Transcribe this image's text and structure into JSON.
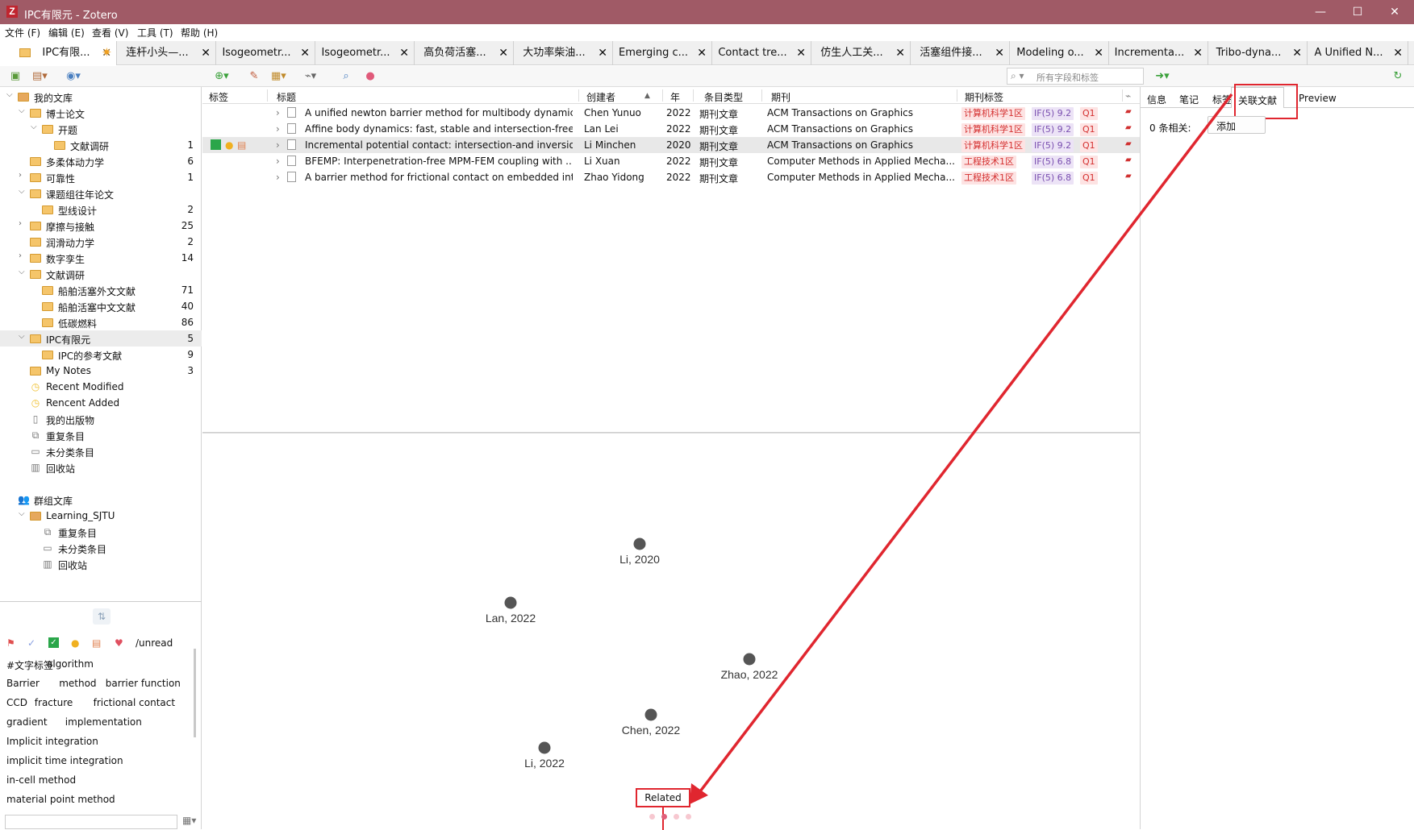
{
  "window": {
    "title": "IPC有限元 - Zotero",
    "logo": "Z",
    "minimize": "—",
    "maximize": "☐",
    "close": "✕"
  },
  "menu": [
    "文件 (F)",
    "编辑 (E)",
    "查看 (V)",
    "工具 (T)",
    "帮助 (H)"
  ],
  "tabs": [
    {
      "label": "IPC有限...",
      "active": true
    },
    {
      "label": "连杆小头—..."
    },
    {
      "label": "Isogeometr..."
    },
    {
      "label": "Isogeometr..."
    },
    {
      "label": "高负荷活塞..."
    },
    {
      "label": "大功率柴油..."
    },
    {
      "label": "Emerging c..."
    },
    {
      "label": "Contact tre..."
    },
    {
      "label": "仿生人工关..."
    },
    {
      "label": "活塞组件接..."
    },
    {
      "label": "Modeling o..."
    },
    {
      "label": "Incrementa..."
    },
    {
      "label": "Tribo-dyna..."
    },
    {
      "label": "A Unified N..."
    }
  ],
  "tab_close": "✕",
  "search": {
    "placeholder": "所有字段和标签"
  },
  "collections": [
    {
      "name": "我的文库",
      "level": 0,
      "chev": "v",
      "icon": "lib"
    },
    {
      "name": "博士论文",
      "level": 1,
      "chev": "v",
      "icon": "folder"
    },
    {
      "name": "开题",
      "level": 2,
      "chev": "v",
      "icon": "folder"
    },
    {
      "name": "文献调研",
      "level": 3,
      "icon": "folder",
      "count": "1"
    },
    {
      "name": "多柔体动力学",
      "level": 1,
      "icon": "folder",
      "count": "6"
    },
    {
      "name": "可靠性",
      "level": 1,
      "chev": ">",
      "icon": "folder",
      "count": "1"
    },
    {
      "name": "课题组往年论文",
      "level": 1,
      "chev": "v",
      "icon": "folder"
    },
    {
      "name": "型线设计",
      "level": 2,
      "icon": "folder",
      "count": "2"
    },
    {
      "name": "摩擦与接触",
      "level": 1,
      "chev": ">",
      "icon": "folder",
      "count": "25"
    },
    {
      "name": "润滑动力学",
      "level": 1,
      "icon": "folder",
      "count": "2"
    },
    {
      "name": "数字孪生",
      "level": 1,
      "chev": ">",
      "icon": "folder",
      "count": "14"
    },
    {
      "name": "文献调研",
      "level": 1,
      "chev": "v",
      "icon": "folder"
    },
    {
      "name": "船舶活塞外文文献",
      "level": 2,
      "icon": "folder",
      "count": "71"
    },
    {
      "name": "船舶活塞中文文献",
      "level": 2,
      "icon": "folder",
      "count": "40"
    },
    {
      "name": "低碳燃料",
      "level": 2,
      "icon": "folder",
      "count": "86"
    },
    {
      "name": "IPC有限元",
      "level": 1,
      "chev": "v",
      "icon": "folder",
      "count": "5",
      "selected": true
    },
    {
      "name": "IPC的参考文献",
      "level": 2,
      "icon": "folder",
      "count": "9"
    },
    {
      "name": "My Notes",
      "level": 1,
      "icon": "folder",
      "count": "3"
    },
    {
      "name": "Recent Modified",
      "level": 1,
      "icon": "clock"
    },
    {
      "name": "Rencent Added",
      "level": 1,
      "icon": "clock"
    },
    {
      "name": "我的出版物",
      "level": 1,
      "icon": "doc"
    },
    {
      "name": "重复条目",
      "level": 1,
      "icon": "dup"
    },
    {
      "name": "未分类条目",
      "level": 1,
      "icon": "unfiled"
    },
    {
      "name": "回收站",
      "level": 1,
      "icon": "trash"
    }
  ],
  "groups": [
    {
      "name": "群组文库",
      "level": 0,
      "icon": "group"
    },
    {
      "name": "Learning_SJTU",
      "level": 1,
      "chev": "v",
      "icon": "lib"
    },
    {
      "name": "重复条目",
      "level": 2,
      "icon": "dup"
    },
    {
      "name": "未分类条目",
      "level": 2,
      "icon": "unfiled"
    },
    {
      "name": "回收站",
      "level": 2,
      "icon": "trash"
    }
  ],
  "tags": {
    "unread": "/unread",
    "rows": [
      [
        "#文字标签",
        "algorithm"
      ],
      [
        "Barrier",
        "method",
        "barrier function"
      ],
      [
        "CCD",
        "fracture",
        "frictional contact"
      ],
      [
        "gradient",
        "implementation"
      ],
      [
        "Implicit integration"
      ],
      [
        "implicit time integration"
      ],
      [
        "in-cell method"
      ],
      [
        "material point method"
      ]
    ]
  },
  "columns": {
    "tags": "标签",
    "title": "标题",
    "creator": "创建者",
    "year": "年",
    "type": "条目类型",
    "journal": "期刊",
    "jtags": "期刊标签"
  },
  "items": [
    {
      "title": "A unified newton barrier method for multibody dynamics",
      "creator": "Chen Yunuo",
      "year": "2022",
      "type": "期刊文章",
      "journal": "ACM Transactions on Graphics",
      "zone": "计算机科学1区",
      "if": "IF(5) 9.2",
      "q": "Q1"
    },
    {
      "title": "Affine body dynamics: fast, stable and intersection-free ...",
      "creator": "Lan Lei",
      "year": "2022",
      "type": "期刊文章",
      "journal": "ACM Transactions on Graphics",
      "zone": "计算机科学1区",
      "if": "IF(5) 9.2",
      "q": "Q1"
    },
    {
      "title": "Incremental potential contact: intersection-and inversio...",
      "creator": "Li Minchen",
      "year": "2020",
      "type": "期刊文章",
      "journal": "ACM Transactions on Graphics",
      "zone": "计算机科学1区",
      "if": "IF(5) 9.2",
      "q": "Q1",
      "selected": true
    },
    {
      "title": "BFEMP: Interpenetration-free MPM-FEM coupling with ...",
      "creator": "Li Xuan",
      "year": "2022",
      "type": "期刊文章",
      "journal": "Computer Methods in Applied Mecha...",
      "zone": "工程技术1区",
      "if": "IF(5) 6.8",
      "q": "Q1"
    },
    {
      "title": "A barrier method for frictional contact on embedded int...",
      "creator": "Zhao Yidong",
      "year": "2022",
      "type": "期刊文章",
      "journal": "Computer Methods in Applied Mecha...",
      "zone": "工程技术1区",
      "if": "IF(5) 6.8",
      "q": "Q1"
    }
  ],
  "graph": {
    "nodes": [
      {
        "label": "Li, 2020"
      },
      {
        "label": "Lan, 2022"
      },
      {
        "label": "Zhao, 2022"
      },
      {
        "label": "Chen, 2022"
      },
      {
        "label": "Li, 2022"
      }
    ],
    "button": "Related"
  },
  "right": {
    "tabs": [
      "信息",
      "笔记",
      "标签",
      "关联文献",
      "Preview"
    ],
    "related_count": "0 条相关:",
    "add": "添加"
  },
  "colors": {
    "titlebar": "#a05a66",
    "accent_red": "#e0262f"
  }
}
